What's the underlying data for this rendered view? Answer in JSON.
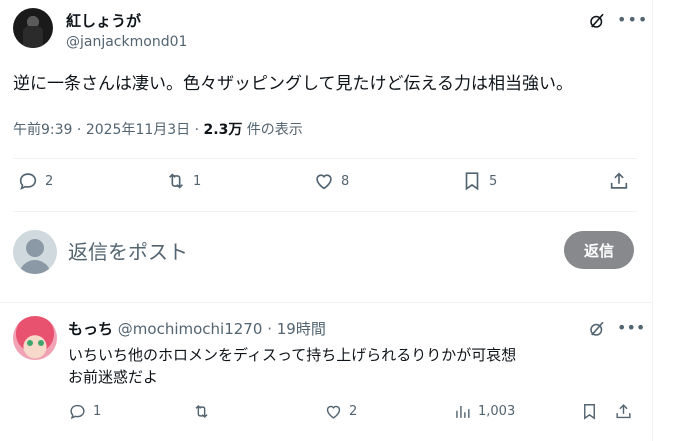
{
  "main_tweet": {
    "display_name": "紅しょうが",
    "handle": "@janjackmond01",
    "text": "逆に一条さんは凄い。色々ザッピングして見たけど伝える力は相当強い。",
    "time": "午前9:39",
    "date": "2025年11月3日",
    "views_count": "2.3万",
    "views_label": "件の表示",
    "separator": "·",
    "actions": {
      "replies": "2",
      "retweets": "1",
      "likes": "8",
      "bookmarks": "5"
    }
  },
  "composer": {
    "placeholder": "返信をポスト",
    "reply_button": "返信"
  },
  "reply_tweet": {
    "display_name": "もっち",
    "handle": "@mochimochi1270",
    "separator": "·",
    "time": "19時間",
    "text_line1": "いちいち他のホロメンをディスって持ち上げられるりりかが可哀想",
    "text_line2": "お前迷惑だよ",
    "actions": {
      "replies": "1",
      "retweets": "",
      "likes": "2",
      "views": "1,003"
    }
  },
  "icons": {
    "more": "more-dots-icon",
    "grok": "grok-slash-icon",
    "reply": "speech-bubble-icon",
    "retweet": "retweet-icon",
    "like": "heart-icon",
    "bookmark": "bookmark-icon",
    "share": "share-upload-icon",
    "views": "bar-chart-icon"
  },
  "colors": {
    "text_primary": "#0f1419",
    "text_secondary": "#536471",
    "divider": "#eff3f4",
    "reply_button_bg": "#87898c"
  }
}
